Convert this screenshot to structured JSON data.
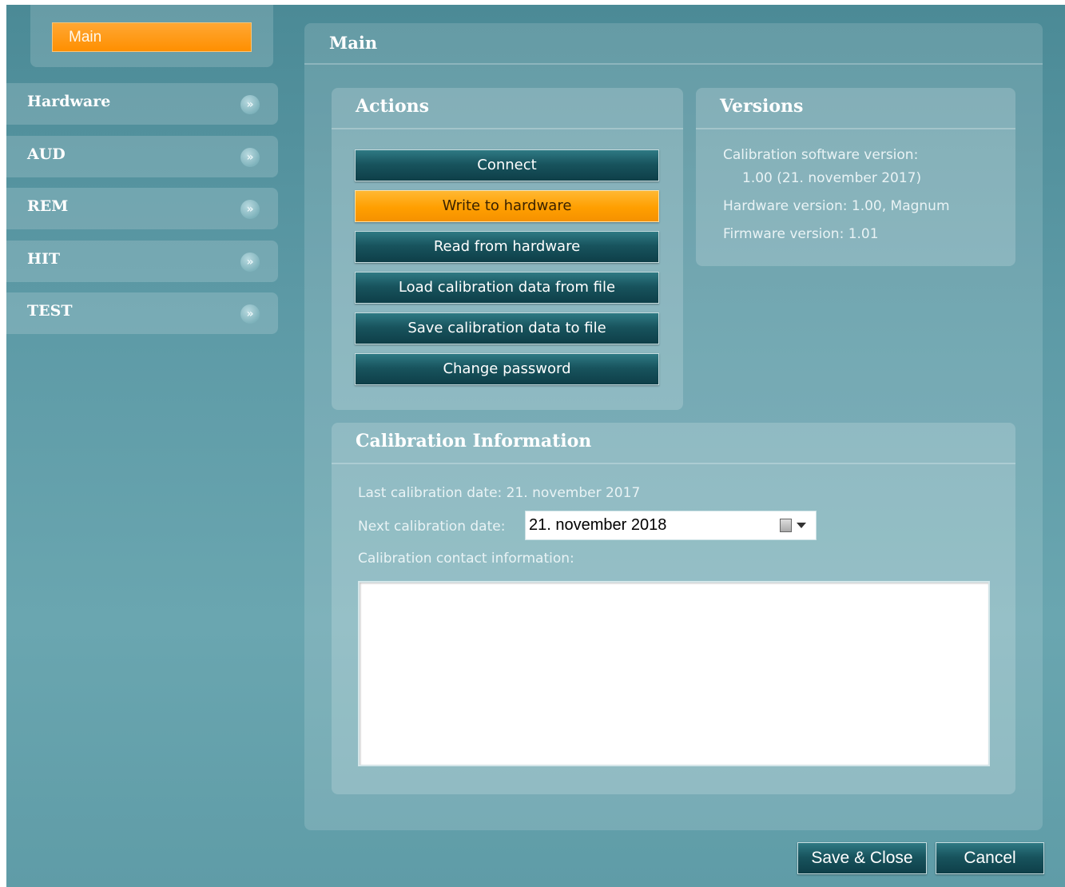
{
  "sidebar": {
    "selected_label": "Main",
    "items": [
      {
        "label": "Hardware"
      },
      {
        "label": "AUD"
      },
      {
        "label": "REM"
      },
      {
        "label": "HIT"
      },
      {
        "label": "TEST"
      }
    ],
    "chevron_glyph": "»"
  },
  "main": {
    "title": "Main",
    "actions": {
      "title": "Actions",
      "buttons": [
        {
          "label": "Connect"
        },
        {
          "label": "Write to hardware"
        },
        {
          "label": "Read from hardware"
        },
        {
          "label": "Load calibration data from file"
        },
        {
          "label": "Save calibration data to file"
        },
        {
          "label": "Change password"
        }
      ]
    },
    "versions": {
      "title": "Versions",
      "calibration_software_label": "Calibration software version:",
      "calibration_software_value": "1.00  (21. november 2017)",
      "hardware_version": "Hardware version: 1.00, Magnum",
      "firmware_version": "Firmware version: 1.01"
    },
    "calibration": {
      "title": "Calibration Information",
      "last_date": "Last calibration date: 21. november 2017",
      "next_date_label": "Next calibration date:",
      "next_date_value": "21. november 2018",
      "contact_label": "Calibration contact information:",
      "contact_value": ""
    }
  },
  "footer": {
    "save_close_label": "Save & Close",
    "cancel_label": "Cancel"
  },
  "colors": {
    "accent_orange": "#ff9f00",
    "button_teal": "#18545e",
    "background_teal": "#5d9aa6"
  }
}
